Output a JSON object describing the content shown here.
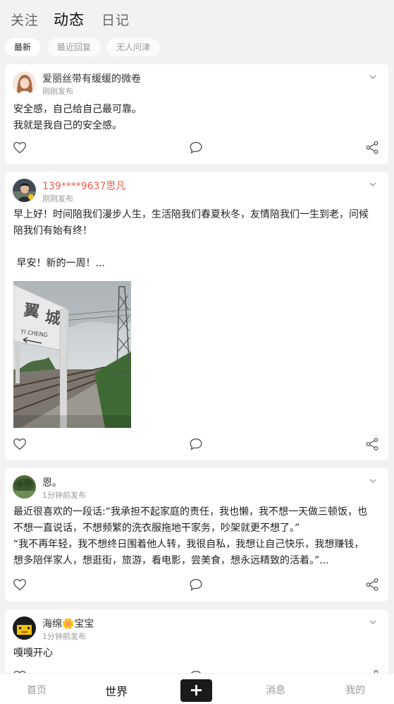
{
  "top_tabs": [
    {
      "label": "关注"
    },
    {
      "label": "动态"
    },
    {
      "label": "日记"
    }
  ],
  "filters": [
    {
      "label": "最新"
    },
    {
      "label": "最近回复"
    },
    {
      "label": "无人问津"
    }
  ],
  "posts": [
    {
      "user": "爱丽丝带有缓缓的微卷",
      "time": "刚刚发布",
      "lines": [
        "安全感，自己给自己最可靠。",
        "我就是我自己的安全感。"
      ]
    },
    {
      "user": "139****9637思凡",
      "time": "刚刚发布",
      "lines": [
        "早上好！时间陪我们漫步人生，生活陪我们春夏秋冬，友情陪我们一生到老，问候",
        "陪我们有始有终！",
        "",
        " 早安！新的一周！..."
      ],
      "image_sign_text": "YI CHENG"
    },
    {
      "user": "恩。",
      "time": "1分钟前发布",
      "lines": [
        "最近很喜欢的一段话:“我承担不起家庭的责任，我也懒，我不想一天做三顿饭，也",
        "不想一直说话，不想频繁的洗衣服拖地干家务，吵架就更不想了。”",
        "“我不再年轻，我不想终日围着他人转，我很自私，我想让自己快乐，我想赚钱，",
        "想多陪伴家人，想逛街，旅游，看电影，尝美食，想永远精致的活着。”..."
      ]
    },
    {
      "user": "海绵🌼宝宝",
      "time": "1分钟前发布",
      "lines": [
        "嘎嘎开心"
      ]
    }
  ],
  "bottom_nav": {
    "home": "首页",
    "world": "世界",
    "messages": "消息",
    "mine": "我的"
  },
  "colors": {
    "vip_name": "#e8604c",
    "background": "#f2f2f2"
  }
}
